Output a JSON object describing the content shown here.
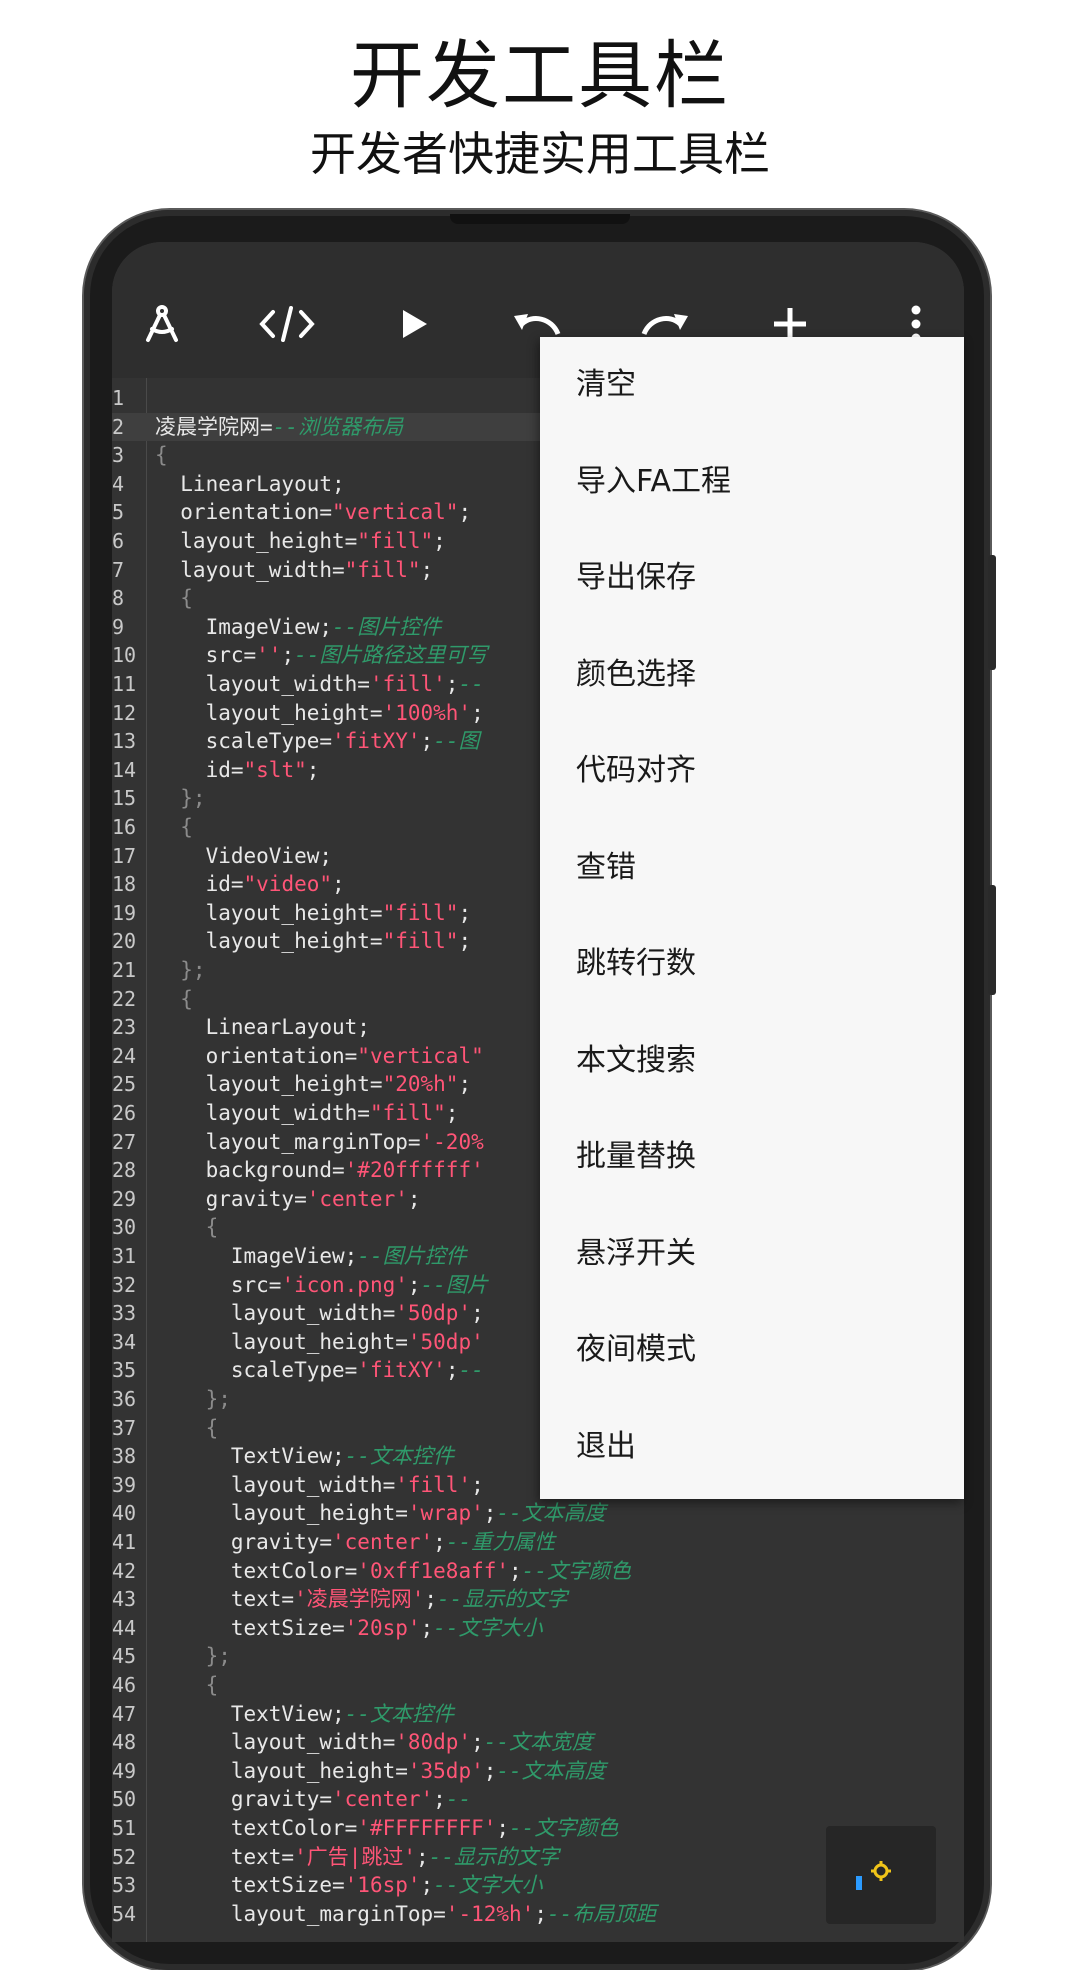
{
  "promo": {
    "title": "开发工具栏",
    "subtitle": "开发者快捷实用工具栏"
  },
  "toolbar": {
    "icons": [
      "compass-icon",
      "code-icon",
      "play-icon",
      "undo-icon",
      "redo-icon",
      "add-icon",
      "more-vert-icon"
    ]
  },
  "menu": {
    "items": [
      "清空",
      "导入FA工程",
      "导出保存",
      "颜色选择",
      "代码对齐",
      "查错",
      "跳转行数",
      "本文搜索",
      "批量替换",
      "悬浮开关",
      "夜间模式",
      "退出"
    ]
  },
  "colors": {
    "string": "#ff5577",
    "comment": "#2f9a6a",
    "code": "#e8e8e8",
    "editor_bg": "#333333",
    "menu_bg": "#f7f7f7",
    "float_icon": "#f0c419"
  },
  "editor": {
    "lines": [
      {
        "n": "1",
        "segs": []
      },
      {
        "n": "2",
        "segs": [
          [
            "p",
            "凌晨学院网="
          ],
          [
            "c",
            "--浏览器布局"
          ]
        ]
      },
      {
        "n": "3",
        "segs": [
          [
            "b",
            "{"
          ]
        ]
      },
      {
        "n": "4",
        "segs": [
          [
            "p",
            "  LinearLayout;"
          ]
        ]
      },
      {
        "n": "5",
        "segs": [
          [
            "p",
            "  orientation="
          ],
          [
            "s",
            "\"vertical\""
          ],
          [
            "p",
            ";"
          ]
        ]
      },
      {
        "n": "6",
        "segs": [
          [
            "p",
            "  layout_height="
          ],
          [
            "s",
            "\"fill\""
          ],
          [
            "p",
            ";"
          ]
        ]
      },
      {
        "n": "7",
        "segs": [
          [
            "p",
            "  layout_width="
          ],
          [
            "s",
            "\"fill\""
          ],
          [
            "p",
            ";"
          ]
        ]
      },
      {
        "n": "8",
        "segs": [
          [
            "b",
            "  {"
          ]
        ]
      },
      {
        "n": "9",
        "segs": [
          [
            "p",
            "    ImageView;"
          ],
          [
            "c",
            "--图片控件"
          ]
        ]
      },
      {
        "n": "10",
        "segs": [
          [
            "p",
            "    src="
          ],
          [
            "s",
            "''"
          ],
          [
            "p",
            ";"
          ],
          [
            "c",
            "--图片路径这里可写"
          ]
        ]
      },
      {
        "n": "11",
        "segs": [
          [
            "p",
            "    layout_width="
          ],
          [
            "s",
            "'fill'"
          ],
          [
            "p",
            ";"
          ],
          [
            "c",
            "--"
          ]
        ]
      },
      {
        "n": "12",
        "segs": [
          [
            "p",
            "    layout_height="
          ],
          [
            "s",
            "'100%h'"
          ],
          [
            "p",
            ";"
          ]
        ]
      },
      {
        "n": "13",
        "segs": [
          [
            "p",
            "    scaleType="
          ],
          [
            "s",
            "'fitXY'"
          ],
          [
            "p",
            ";"
          ],
          [
            "c",
            "--图"
          ]
        ]
      },
      {
        "n": "14",
        "segs": [
          [
            "p",
            "    id="
          ],
          [
            "s",
            "\"slt\""
          ],
          [
            "p",
            ";"
          ]
        ]
      },
      {
        "n": "15",
        "segs": [
          [
            "b",
            "  };"
          ]
        ]
      },
      {
        "n": "16",
        "segs": [
          [
            "b",
            "  {"
          ]
        ]
      },
      {
        "n": "17",
        "segs": [
          [
            "p",
            "    VideoView;"
          ]
        ]
      },
      {
        "n": "18",
        "segs": [
          [
            "p",
            "    id="
          ],
          [
            "s",
            "\"video\""
          ],
          [
            "p",
            ";"
          ]
        ]
      },
      {
        "n": "19",
        "segs": [
          [
            "p",
            "    layout_height="
          ],
          [
            "s",
            "\"fill\""
          ],
          [
            "p",
            ";"
          ]
        ]
      },
      {
        "n": "20",
        "segs": [
          [
            "p",
            "    layout_height="
          ],
          [
            "s",
            "\"fill\""
          ],
          [
            "p",
            ";"
          ]
        ]
      },
      {
        "n": "21",
        "segs": [
          [
            "b",
            "  };"
          ]
        ]
      },
      {
        "n": "22",
        "segs": [
          [
            "b",
            "  {"
          ]
        ]
      },
      {
        "n": "23",
        "segs": [
          [
            "p",
            "    LinearLayout;"
          ]
        ]
      },
      {
        "n": "24",
        "segs": [
          [
            "p",
            "    orientation="
          ],
          [
            "s",
            "\"vertical\""
          ]
        ]
      },
      {
        "n": "25",
        "segs": [
          [
            "p",
            "    layout_height="
          ],
          [
            "s",
            "\"20%h\""
          ],
          [
            "p",
            ";"
          ]
        ]
      },
      {
        "n": "26",
        "segs": [
          [
            "p",
            "    layout_width="
          ],
          [
            "s",
            "\"fill\""
          ],
          [
            "p",
            ";"
          ]
        ]
      },
      {
        "n": "27",
        "segs": [
          [
            "p",
            "    layout_marginTop="
          ],
          [
            "s",
            "'-20%"
          ]
        ]
      },
      {
        "n": "28",
        "segs": [
          [
            "p",
            "    background="
          ],
          [
            "s",
            "'#20ffffff'"
          ]
        ]
      },
      {
        "n": "29",
        "segs": [
          [
            "p",
            "    gravity="
          ],
          [
            "s",
            "'center'"
          ],
          [
            "p",
            ";"
          ]
        ]
      },
      {
        "n": "30",
        "segs": [
          [
            "b",
            "    {"
          ]
        ]
      },
      {
        "n": "31",
        "segs": [
          [
            "p",
            "      ImageView;"
          ],
          [
            "c",
            "--图片控件"
          ]
        ]
      },
      {
        "n": "32",
        "segs": [
          [
            "p",
            "      src="
          ],
          [
            "s",
            "'icon.png'"
          ],
          [
            "p",
            ";"
          ],
          [
            "c",
            "--图片"
          ]
        ]
      },
      {
        "n": "33",
        "segs": [
          [
            "p",
            "      layout_width="
          ],
          [
            "s",
            "'50dp'"
          ],
          [
            "p",
            ";"
          ]
        ]
      },
      {
        "n": "34",
        "segs": [
          [
            "p",
            "      layout_height="
          ],
          [
            "s",
            "'50dp'"
          ]
        ]
      },
      {
        "n": "35",
        "segs": [
          [
            "p",
            "      scaleType="
          ],
          [
            "s",
            "'fitXY'"
          ],
          [
            "p",
            ";"
          ],
          [
            "c",
            "--"
          ]
        ]
      },
      {
        "n": "36",
        "segs": [
          [
            "b",
            "    };"
          ]
        ]
      },
      {
        "n": "37",
        "segs": [
          [
            "b",
            "    {"
          ]
        ]
      },
      {
        "n": "38",
        "segs": [
          [
            "p",
            "      TextView;"
          ],
          [
            "c",
            "--文本控件"
          ]
        ]
      },
      {
        "n": "39",
        "segs": [
          [
            "p",
            "      layout_width="
          ],
          [
            "s",
            "'fill'"
          ],
          [
            "p",
            ";"
          ]
        ]
      },
      {
        "n": "40",
        "segs": [
          [
            "p",
            "      layout_height="
          ],
          [
            "s",
            "'wrap'"
          ],
          [
            "p",
            ";"
          ],
          [
            "c",
            "--文本高度"
          ]
        ]
      },
      {
        "n": "41",
        "segs": [
          [
            "p",
            "      gravity="
          ],
          [
            "s",
            "'center'"
          ],
          [
            "p",
            ";"
          ],
          [
            "c",
            "--重力属性"
          ]
        ]
      },
      {
        "n": "42",
        "segs": [
          [
            "p",
            "      textColor="
          ],
          [
            "s",
            "'0xff1e8aff'"
          ],
          [
            "p",
            ";"
          ],
          [
            "c",
            "--文字颜色"
          ]
        ]
      },
      {
        "n": "43",
        "segs": [
          [
            "p",
            "      text="
          ],
          [
            "s",
            "'凌晨学院网'"
          ],
          [
            "p",
            ";"
          ],
          [
            "c",
            "--显示的文字"
          ]
        ]
      },
      {
        "n": "44",
        "segs": [
          [
            "p",
            "      textSize="
          ],
          [
            "s",
            "'20sp'"
          ],
          [
            "p",
            ";"
          ],
          [
            "c",
            "--文字大小"
          ]
        ]
      },
      {
        "n": "45",
        "segs": [
          [
            "b",
            "    };"
          ]
        ]
      },
      {
        "n": "46",
        "segs": [
          [
            "b",
            "    {"
          ]
        ]
      },
      {
        "n": "47",
        "segs": [
          [
            "p",
            "      TextView;"
          ],
          [
            "c",
            "--文本控件"
          ]
        ]
      },
      {
        "n": "48",
        "segs": [
          [
            "p",
            "      layout_width="
          ],
          [
            "s",
            "'80dp'"
          ],
          [
            "p",
            ";"
          ],
          [
            "c",
            "--文本宽度"
          ]
        ]
      },
      {
        "n": "49",
        "segs": [
          [
            "p",
            "      layout_height="
          ],
          [
            "s",
            "'35dp'"
          ],
          [
            "p",
            ";"
          ],
          [
            "c",
            "--文本高度"
          ]
        ]
      },
      {
        "n": "50",
        "segs": [
          [
            "p",
            "      gravity="
          ],
          [
            "s",
            "'center'"
          ],
          [
            "p",
            ";"
          ],
          [
            "c",
            "--"
          ]
        ]
      },
      {
        "n": "51",
        "segs": [
          [
            "p",
            "      textColor="
          ],
          [
            "s",
            "'#FFFFFFFF'"
          ],
          [
            "p",
            ";"
          ],
          [
            "c",
            "--文字颜色"
          ]
        ]
      },
      {
        "n": "52",
        "segs": [
          [
            "p",
            "      text="
          ],
          [
            "s",
            "'广告|跳过'"
          ],
          [
            "p",
            ";"
          ],
          [
            "c",
            "--显示的文字"
          ]
        ]
      },
      {
        "n": "53",
        "segs": [
          [
            "p",
            "      textSize="
          ],
          [
            "s",
            "'16sp'"
          ],
          [
            "p",
            ";"
          ],
          [
            "c",
            "--文字大小"
          ]
        ]
      },
      {
        "n": "54",
        "segs": [
          [
            "p",
            "      layout_marginTop="
          ],
          [
            "s",
            "'-12%h'"
          ],
          [
            "p",
            ";"
          ],
          [
            "c",
            "--布局顶距"
          ]
        ]
      }
    ]
  }
}
